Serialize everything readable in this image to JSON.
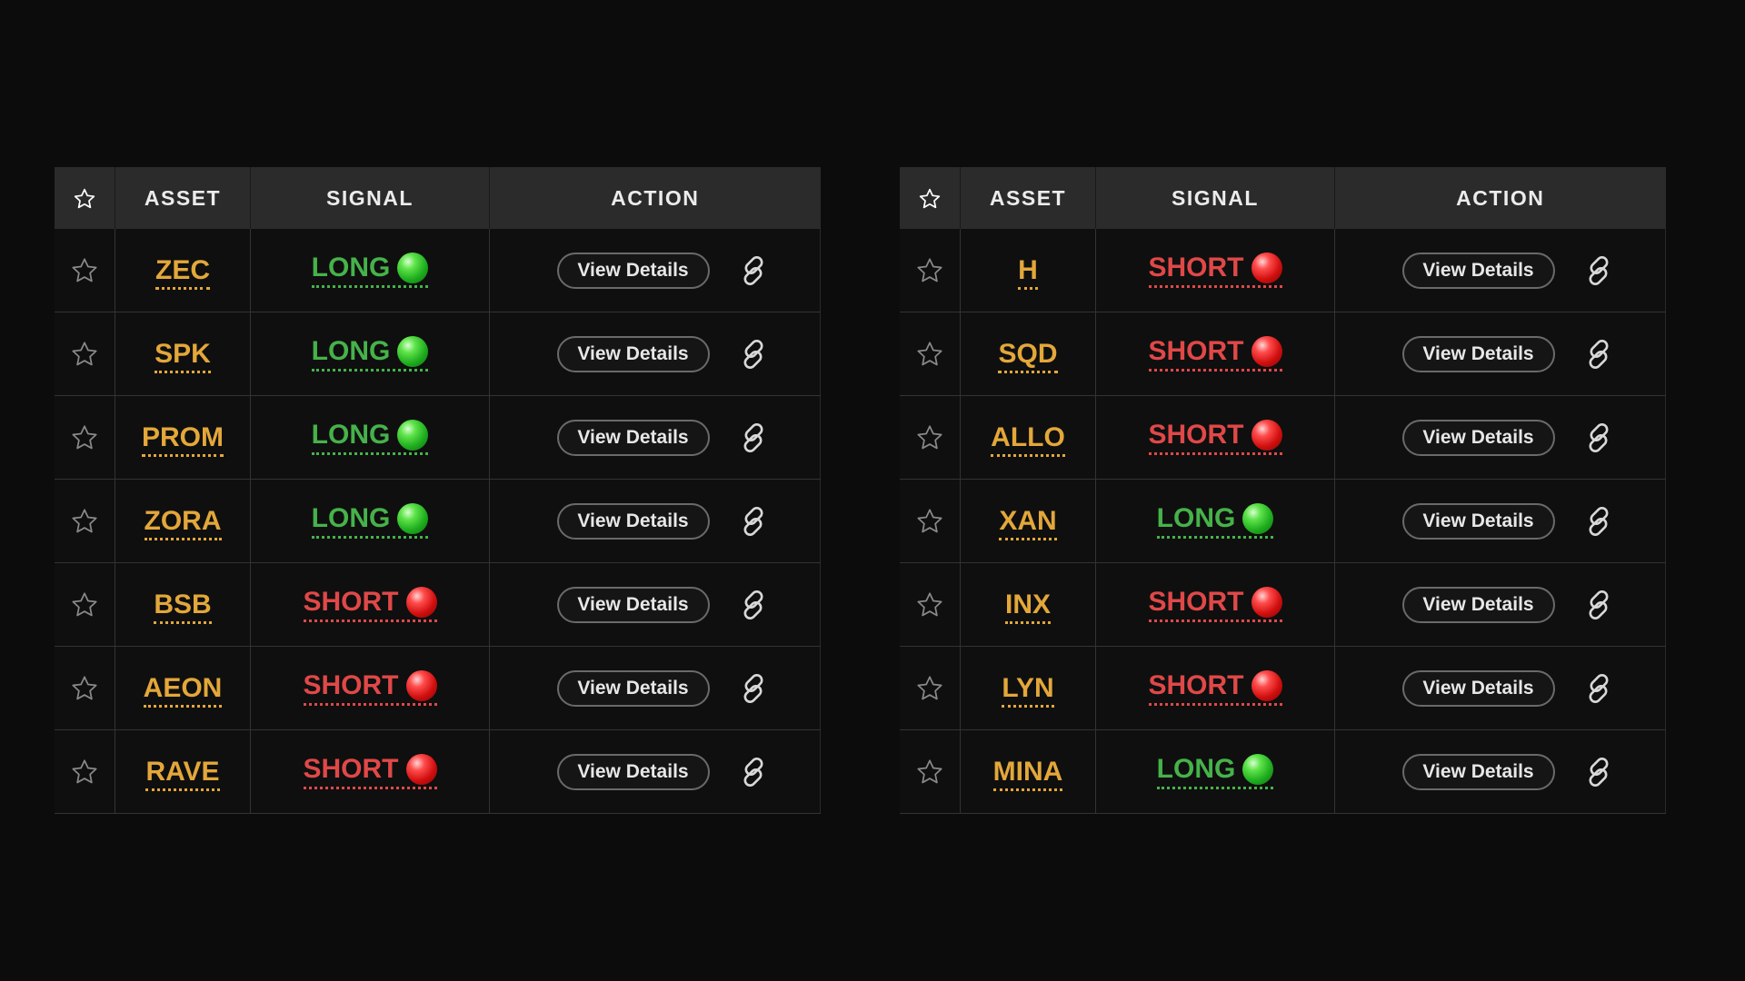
{
  "header": {
    "star": "☆",
    "asset": "ASSET",
    "signal": "SIGNAL",
    "action": "ACTION"
  },
  "button_label": "View Details",
  "colors": {
    "asset": "#e3a73a",
    "long": "#46b24a",
    "short": "#e04848",
    "background": "#0c0c0c",
    "header_bg": "#2b2b2b"
  },
  "icons": {
    "star": "star-outline-icon",
    "long_dot": "green-dot-icon",
    "short_dot": "red-dot-icon",
    "link": "chain-link-icon"
  },
  "tables": [
    {
      "rows": [
        {
          "asset": "ZEC",
          "signal": "LONG"
        },
        {
          "asset": "SPK",
          "signal": "LONG"
        },
        {
          "asset": "PROM",
          "signal": "LONG"
        },
        {
          "asset": "ZORA",
          "signal": "LONG"
        },
        {
          "asset": "BSB",
          "signal": "SHORT"
        },
        {
          "asset": "AEON",
          "signal": "SHORT"
        },
        {
          "asset": "RAVE",
          "signal": "SHORT"
        }
      ]
    },
    {
      "rows": [
        {
          "asset": "H",
          "signal": "SHORT"
        },
        {
          "asset": "SQD",
          "signal": "SHORT"
        },
        {
          "asset": "ALLO",
          "signal": "SHORT"
        },
        {
          "asset": "XAN",
          "signal": "LONG"
        },
        {
          "asset": "INX",
          "signal": "SHORT"
        },
        {
          "asset": "LYN",
          "signal": "SHORT"
        },
        {
          "asset": "MINA",
          "signal": "LONG"
        }
      ]
    }
  ]
}
